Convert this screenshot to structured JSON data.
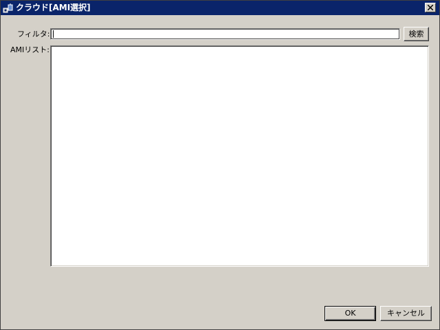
{
  "window": {
    "title": "クラウド[AMI選択]"
  },
  "filter": {
    "label": "フィルタ:",
    "value": "",
    "search_label": "検索"
  },
  "ami_list": {
    "label": "AMIリスト:",
    "items": []
  },
  "footer": {
    "ok_label": "OK",
    "cancel_label": "キャンセル"
  },
  "colors": {
    "titlebar": "#0a246a",
    "face": "#d4d0c8"
  }
}
